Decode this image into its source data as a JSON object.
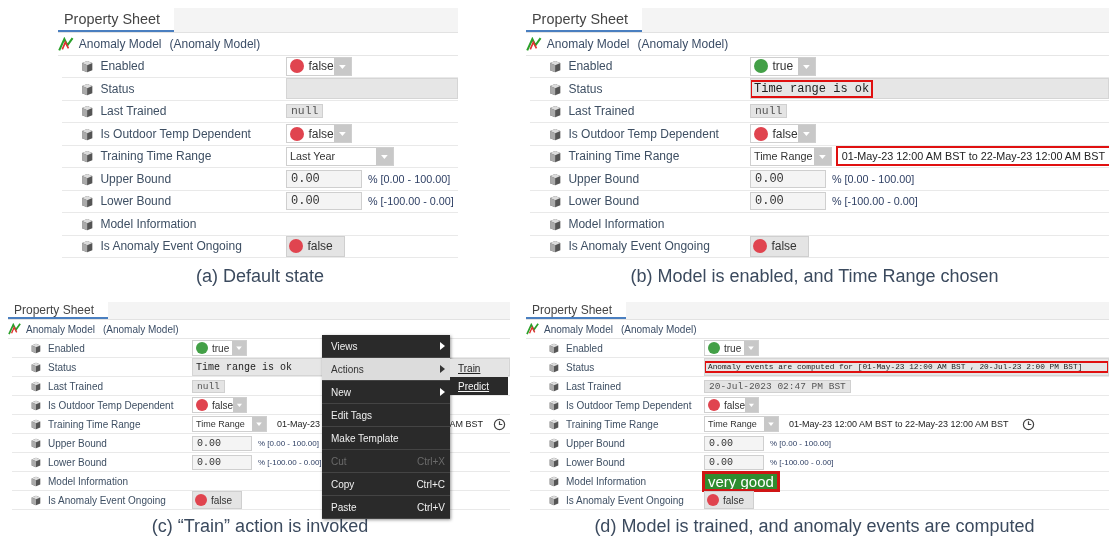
{
  "panels": [
    {
      "tab": "Property Sheet",
      "name": "Anomaly Model",
      "type": "(Anomaly Model)",
      "caption": "(a) Default state",
      "rows": [
        {
          "kind": "toggle",
          "label": "Enabled",
          "value": "false",
          "color": "#e0444f"
        },
        {
          "kind": "text",
          "label": "Status"
        },
        {
          "kind": "readonly",
          "label": "Last Trained",
          "value": "null"
        },
        {
          "kind": "toggle",
          "label": "Is Outdoor Temp Dependent",
          "value": "false",
          "color": "#e0444f"
        },
        {
          "kind": "select",
          "label": "Training Time Range",
          "value": "Last Year"
        },
        {
          "kind": "number",
          "label": "Upper Bound",
          "value": "0.00",
          "hint": "% [0.00 - 100.00]"
        },
        {
          "kind": "number",
          "label": "Lower Bound",
          "value": "0.00",
          "hint": "% [-100.00 - 0.00]"
        },
        {
          "kind": "info",
          "label": "Model Information"
        },
        {
          "kind": "badge",
          "label": "Is Anomaly Event Ongoing",
          "value": "false",
          "color": "#e0444f"
        }
      ]
    },
    {
      "tab": "Property Sheet",
      "name": "Anomaly Model",
      "type": "(Anomaly Model)",
      "caption": "(b) Model is enabled, and Time Range chosen",
      "rows": [
        {
          "kind": "toggle",
          "label": "Enabled",
          "value": "true",
          "color": "#43a047"
        },
        {
          "kind": "text",
          "label": "Status",
          "value": "Time range is ok",
          "highlighted": true
        },
        {
          "kind": "readonly",
          "label": "Last Trained",
          "value": "null"
        },
        {
          "kind": "toggle",
          "label": "Is Outdoor Temp Dependent",
          "value": "false",
          "color": "#e0444f"
        },
        {
          "kind": "select",
          "label": "Training Time Range",
          "value": "Time Range",
          "range": "01-May-23 12:00 AM BST to 22-May-23 12:00 AM BST",
          "highlighted": true
        },
        {
          "kind": "number",
          "label": "Upper Bound",
          "value": "0.00",
          "hint": "% [0.00 - 100.00]"
        },
        {
          "kind": "number",
          "label": "Lower Bound",
          "value": "0.00",
          "hint": "% [-100.00 - 0.00]"
        },
        {
          "kind": "info",
          "label": "Model Information"
        },
        {
          "kind": "badge",
          "label": "Is Anomaly Event Ongoing",
          "value": "false",
          "color": "#e0444f"
        }
      ]
    },
    {
      "tab": "Property Sheet",
      "name": "Anomaly Model",
      "type": "(Anomaly Model)",
      "caption": "(c) “Train” action is invoked",
      "rows": [
        {
          "kind": "toggle",
          "label": "Enabled",
          "value": "true",
          "color": "#43a047"
        },
        {
          "kind": "text",
          "label": "Status",
          "value": "Time range is ok"
        },
        {
          "kind": "readonly",
          "label": "Last Trained",
          "value": "null"
        },
        {
          "kind": "toggle",
          "label": "Is Outdoor Temp Dependent",
          "value": "false",
          "color": "#e0444f"
        },
        {
          "kind": "select",
          "label": "Training Time Range",
          "value": "Time Range",
          "range": "01-May-23",
          "range_tail": "AM BST",
          "clock": true
        },
        {
          "kind": "number",
          "label": "Upper Bound",
          "value": "0.00",
          "hint": "% [0.00 - 100.00]"
        },
        {
          "kind": "number",
          "label": "Lower Bound",
          "value": "0.00",
          "hint": "% [-100.00 - 0.00]"
        },
        {
          "kind": "info",
          "label": "Model Information"
        },
        {
          "kind": "badge",
          "label": "Is Anomaly Event Ongoing",
          "value": "false",
          "color": "#e0444f"
        }
      ],
      "menu": {
        "items": [
          {
            "label": "Views",
            "submenu": true,
            "selected": false,
            "disabled": false
          },
          {
            "label": "Actions",
            "submenu": true,
            "selected": true,
            "disabled": false
          },
          {
            "label": "New",
            "submenu": true,
            "selected": false,
            "disabled": false
          },
          {
            "label": "Edit Tags",
            "submenu": false,
            "selected": false,
            "disabled": false
          },
          {
            "label": "Make Template",
            "submenu": false,
            "selected": false,
            "disabled": false
          },
          {
            "label": "Cut",
            "shortcut": "Ctrl+X",
            "submenu": false,
            "selected": false,
            "disabled": true
          },
          {
            "label": "Copy",
            "shortcut": "Ctrl+C",
            "submenu": false,
            "selected": false,
            "disabled": false
          },
          {
            "label": "Paste",
            "shortcut": "Ctrl+V",
            "submenu": false,
            "selected": false,
            "disabled": false
          }
        ],
        "submenu": [
          {
            "label": "Train",
            "selected": true
          },
          {
            "label": "Predict",
            "selected": false
          }
        ]
      }
    },
    {
      "tab": "Property Sheet",
      "name": "Anomaly Model",
      "type": "(Anomaly Model)",
      "caption": "(d) Model is trained, and anomaly events are computed",
      "rows": [
        {
          "kind": "toggle",
          "label": "Enabled",
          "value": "true",
          "color": "#43a047"
        },
        {
          "kind": "text",
          "label": "Status",
          "value": "Anomaly events are computed for [01-May-23 12:00 AM BST , 20-Jul-23 2:00 PM BST]",
          "highlighted": true
        },
        {
          "kind": "readonly",
          "label": "Last Trained",
          "value": "20-Jul-2023 02:47 PM BST"
        },
        {
          "kind": "toggle",
          "label": "Is Outdoor Temp Dependent",
          "value": "false",
          "color": "#e0444f"
        },
        {
          "kind": "select",
          "label": "Training Time Range",
          "value": "Time Range",
          "range": "01-May-23 12:00 AM BST to 22-May-23 12:00 AM BST",
          "clock": true
        },
        {
          "kind": "number",
          "label": "Upper Bound",
          "value": "0.00",
          "hint": "% [0.00 - 100.00]"
        },
        {
          "kind": "number",
          "label": "Lower Bound",
          "value": "0.00",
          "hint": "% [-100.00 - 0.00]"
        },
        {
          "kind": "info",
          "label": "Model Information",
          "value": "very good",
          "highlighted": true
        },
        {
          "kind": "badge",
          "label": "Is Anomaly Event Ongoing",
          "value": "false",
          "color": "#e0444f"
        }
      ]
    }
  ]
}
